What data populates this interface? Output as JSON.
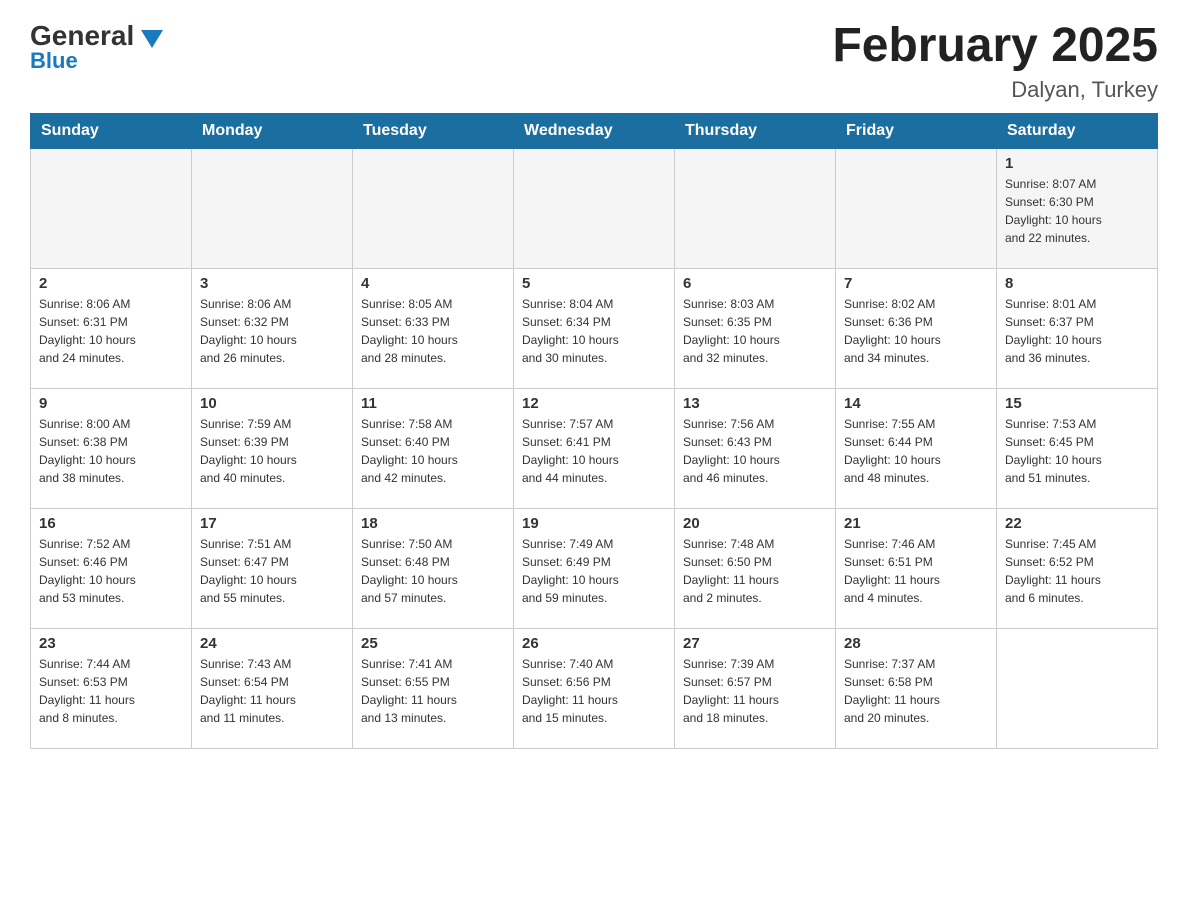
{
  "header": {
    "logo_general": "General",
    "logo_blue": "Blue",
    "title": "February 2025",
    "subtitle": "Dalyan, Turkey"
  },
  "days": [
    "Sunday",
    "Monday",
    "Tuesday",
    "Wednesday",
    "Thursday",
    "Friday",
    "Saturday"
  ],
  "weeks": [
    [
      {
        "day": "",
        "info": ""
      },
      {
        "day": "",
        "info": ""
      },
      {
        "day": "",
        "info": ""
      },
      {
        "day": "",
        "info": ""
      },
      {
        "day": "",
        "info": ""
      },
      {
        "day": "",
        "info": ""
      },
      {
        "day": "1",
        "info": "Sunrise: 8:07 AM\nSunset: 6:30 PM\nDaylight: 10 hours\nand 22 minutes."
      }
    ],
    [
      {
        "day": "2",
        "info": "Sunrise: 8:06 AM\nSunset: 6:31 PM\nDaylight: 10 hours\nand 24 minutes."
      },
      {
        "day": "3",
        "info": "Sunrise: 8:06 AM\nSunset: 6:32 PM\nDaylight: 10 hours\nand 26 minutes."
      },
      {
        "day": "4",
        "info": "Sunrise: 8:05 AM\nSunset: 6:33 PM\nDaylight: 10 hours\nand 28 minutes."
      },
      {
        "day": "5",
        "info": "Sunrise: 8:04 AM\nSunset: 6:34 PM\nDaylight: 10 hours\nand 30 minutes."
      },
      {
        "day": "6",
        "info": "Sunrise: 8:03 AM\nSunset: 6:35 PM\nDaylight: 10 hours\nand 32 minutes."
      },
      {
        "day": "7",
        "info": "Sunrise: 8:02 AM\nSunset: 6:36 PM\nDaylight: 10 hours\nand 34 minutes."
      },
      {
        "day": "8",
        "info": "Sunrise: 8:01 AM\nSunset: 6:37 PM\nDaylight: 10 hours\nand 36 minutes."
      }
    ],
    [
      {
        "day": "9",
        "info": "Sunrise: 8:00 AM\nSunset: 6:38 PM\nDaylight: 10 hours\nand 38 minutes."
      },
      {
        "day": "10",
        "info": "Sunrise: 7:59 AM\nSunset: 6:39 PM\nDaylight: 10 hours\nand 40 minutes."
      },
      {
        "day": "11",
        "info": "Sunrise: 7:58 AM\nSunset: 6:40 PM\nDaylight: 10 hours\nand 42 minutes."
      },
      {
        "day": "12",
        "info": "Sunrise: 7:57 AM\nSunset: 6:41 PM\nDaylight: 10 hours\nand 44 minutes."
      },
      {
        "day": "13",
        "info": "Sunrise: 7:56 AM\nSunset: 6:43 PM\nDaylight: 10 hours\nand 46 minutes."
      },
      {
        "day": "14",
        "info": "Sunrise: 7:55 AM\nSunset: 6:44 PM\nDaylight: 10 hours\nand 48 minutes."
      },
      {
        "day": "15",
        "info": "Sunrise: 7:53 AM\nSunset: 6:45 PM\nDaylight: 10 hours\nand 51 minutes."
      }
    ],
    [
      {
        "day": "16",
        "info": "Sunrise: 7:52 AM\nSunset: 6:46 PM\nDaylight: 10 hours\nand 53 minutes."
      },
      {
        "day": "17",
        "info": "Sunrise: 7:51 AM\nSunset: 6:47 PM\nDaylight: 10 hours\nand 55 minutes."
      },
      {
        "day": "18",
        "info": "Sunrise: 7:50 AM\nSunset: 6:48 PM\nDaylight: 10 hours\nand 57 minutes."
      },
      {
        "day": "19",
        "info": "Sunrise: 7:49 AM\nSunset: 6:49 PM\nDaylight: 10 hours\nand 59 minutes."
      },
      {
        "day": "20",
        "info": "Sunrise: 7:48 AM\nSunset: 6:50 PM\nDaylight: 11 hours\nand 2 minutes."
      },
      {
        "day": "21",
        "info": "Sunrise: 7:46 AM\nSunset: 6:51 PM\nDaylight: 11 hours\nand 4 minutes."
      },
      {
        "day": "22",
        "info": "Sunrise: 7:45 AM\nSunset: 6:52 PM\nDaylight: 11 hours\nand 6 minutes."
      }
    ],
    [
      {
        "day": "23",
        "info": "Sunrise: 7:44 AM\nSunset: 6:53 PM\nDaylight: 11 hours\nand 8 minutes."
      },
      {
        "day": "24",
        "info": "Sunrise: 7:43 AM\nSunset: 6:54 PM\nDaylight: 11 hours\nand 11 minutes."
      },
      {
        "day": "25",
        "info": "Sunrise: 7:41 AM\nSunset: 6:55 PM\nDaylight: 11 hours\nand 13 minutes."
      },
      {
        "day": "26",
        "info": "Sunrise: 7:40 AM\nSunset: 6:56 PM\nDaylight: 11 hours\nand 15 minutes."
      },
      {
        "day": "27",
        "info": "Sunrise: 7:39 AM\nSunset: 6:57 PM\nDaylight: 11 hours\nand 18 minutes."
      },
      {
        "day": "28",
        "info": "Sunrise: 7:37 AM\nSunset: 6:58 PM\nDaylight: 11 hours\nand 20 minutes."
      },
      {
        "day": "",
        "info": ""
      }
    ]
  ]
}
